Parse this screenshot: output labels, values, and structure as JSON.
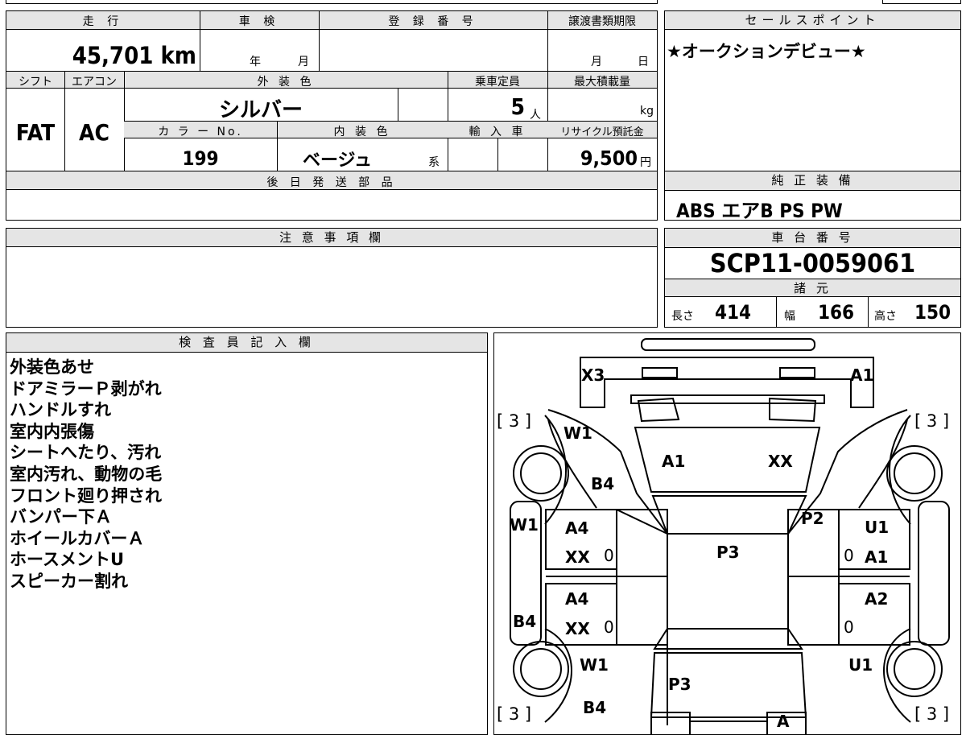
{
  "top_row": {
    "mileage_label": "走 行",
    "inspection_label": "車 検",
    "registration_label": "登 録 番 号",
    "transfer_deadline_label": "譲渡書類期限",
    "mileage_value": "45,701 km",
    "year_unit": "年",
    "month_unit": "月",
    "deadline_month": "月",
    "deadline_day": "日"
  },
  "spec_row": {
    "shift_label": "シフト",
    "aircon_label": "エアコン",
    "exterior_color_label": "外 装 色",
    "capacity_label": "乗車定員",
    "max_load_label": "最大積載量",
    "shift_value": "FAT",
    "aircon_value": "AC",
    "exterior_color_value": "シルバー",
    "capacity_value": "5",
    "capacity_unit": "人",
    "load_unit": "kg",
    "color_no_label": "カ ラ ー No.",
    "interior_color_label": "内 装 色",
    "import_label": "輸 入 車",
    "recycle_label": "リサイクル預託金",
    "color_no_value": "199",
    "interior_color_value": "ベージュ",
    "interior_color_suffix": "系",
    "recycle_value": "9,500",
    "recycle_unit": "円"
  },
  "later_parts": {
    "label": "後 日 発 送 部 品"
  },
  "notes_section": {
    "label": "注 意 事 項 欄"
  },
  "sales_point": {
    "label": "セールスポイント",
    "text": "★オークションデビュー★"
  },
  "equipment": {
    "label": "純 正 装 備",
    "text": "ABS エアB PS PW"
  },
  "chassis": {
    "label": "車 台 番 号",
    "value": "SCP11-0059061"
  },
  "specs": {
    "label": "諸 元",
    "length_label": "長さ",
    "length_value": "414",
    "width_label": "幅",
    "width_value": "166",
    "height_label": "高さ",
    "height_value": "150"
  },
  "inspector": {
    "label": "検 査 員 記 入 欄",
    "notes": [
      "外装色あせ",
      "ドアミラーＰ剥がれ",
      "ハンドルすれ",
      "室内内張傷",
      "シートへたり、汚れ",
      "室内汚れ、動物の毛",
      "フロント廻り押され",
      "バンパー下Ａ",
      "ホイールカバーＡ",
      "ホースメントU",
      "スピーカー割れ"
    ]
  },
  "diagram": {
    "tire_marks": [
      "[ 3 ]",
      "[ 3 ]",
      "[ 3 ]",
      "[ 3 ]"
    ],
    "marks": {
      "x3": "X3",
      "a1_top": "A1",
      "w1_fl": "W1",
      "a1_hood": "A1",
      "xx_hood": "XX",
      "b4_fl": "B4",
      "w1_left": "W1",
      "p2": "P2",
      "a4_fdoor": "A4",
      "xx_fdoor": "XX",
      "p3_roof": "P3",
      "u1_rdoor": "U1",
      "a1_rdoor": "A1",
      "a4_rear": "A4",
      "xx_rear": "XX",
      "a2_rear": "A2",
      "b4_left": "B4",
      "w1_rl": "W1",
      "u1_rr": "U1",
      "p3_trunk": "P3",
      "b4_rear": "B4",
      "a_bottom": "A",
      "zero1": "0",
      "zero2": "0",
      "zero3": "0",
      "zero4": "0"
    }
  }
}
